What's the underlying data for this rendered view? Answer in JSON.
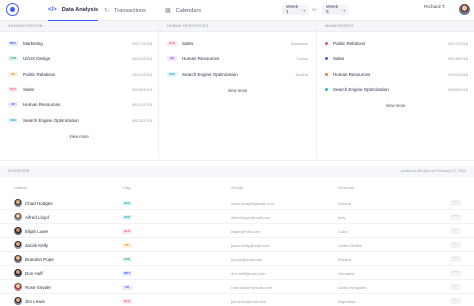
{
  "nav": {
    "tabs": [
      {
        "label": "Data Analysis",
        "icon": "code-icon"
      },
      {
        "label": "Transactions",
        "icon": "refresh-icon"
      },
      {
        "label": "Calendars",
        "icon": "calendar-icon"
      }
    ],
    "week_a": "Week 1",
    "vs": "vs",
    "week_b": "Week 5",
    "user_name": "Richard T."
  },
  "panels": {
    "administration": {
      "header": "ADMINISTRATION",
      "rows": [
        {
          "tag": "MKT",
          "label": "Marketing",
          "date": "05/17/2018"
        },
        {
          "tag": "UXD",
          "label": "UI/UX Design",
          "date": "05/16/2018"
        },
        {
          "tag": "PR",
          "label": "Public Relations",
          "date": "05/11/2018"
        },
        {
          "tag": "SLS",
          "label": "Sales",
          "date": "05/09/2018"
        },
        {
          "tag": "HR",
          "label": "Human Resources",
          "date": "06/01/2018"
        },
        {
          "tag": "SEO",
          "label": "Search Engine Optimization",
          "date": "08/25/2018"
        }
      ],
      "more": "View more"
    },
    "human_resources": {
      "header": "HUMAN RESOURCES",
      "rows": [
        {
          "tag": "SLS",
          "label": "Sales",
          "location": "Barbados"
        },
        {
          "tag": "HR",
          "label": "Human Resources",
          "location": "Turkey"
        },
        {
          "tag": "SEO",
          "label": "Search Engine Optimization",
          "location": "Austria"
        }
      ],
      "more": "View more"
    },
    "management": {
      "header": "MANAGEMENT",
      "rows": [
        {
          "label": "Public Relations",
          "date": "05/17/2018",
          "color": "#e2547a"
        },
        {
          "label": "Sales",
          "date": "05/16/2018",
          "color": "#3d5cff"
        },
        {
          "label": "Human Resources",
          "date": "05/11/2018",
          "color": "#f07a3a"
        },
        {
          "label": "Search Engine Optimization",
          "date": "05/09/2018",
          "color": "#22b8c8"
        }
      ],
      "more": "View more"
    }
  },
  "overview": {
    "title": "OVERVIEW",
    "note": "posted at 08:14pm on February 27, 2022",
    "columns": {
      "name": "Name",
      "tag": "Tag",
      "email": "Email",
      "country": "Country"
    },
    "rows": [
      {
        "name": "Chad Hodges",
        "tag": "SEO",
        "email": "chad.hodges@mail.com",
        "country": "Greece"
      },
      {
        "name": "Alfred Lloyd",
        "tag": "SEO",
        "email": "alfred.lloyd@mail.com",
        "country": "Italy"
      },
      {
        "name": "Elijah Lowe",
        "tag": "SLS",
        "email": "elijah@mail.com",
        "country": "Cuba"
      },
      {
        "name": "Jacob Kelly",
        "tag": "PR",
        "email": "jacob.kelly@mail.com",
        "country": "United States"
      },
      {
        "name": "Brandon Pope",
        "tag": "UXD",
        "email": "bpope@mail.com",
        "country": "Finland"
      },
      {
        "name": "Don Huff",
        "tag": "MKT",
        "email": "don.huff@mail.com",
        "country": "Germany"
      },
      {
        "name": "Rose Snyder",
        "tag": "HR",
        "email": "rose.snyder@mail.com",
        "country": "United Kingdom"
      },
      {
        "name": "Jim Lewis",
        "tag": "SLS",
        "email": "jim.lewis@mail.com",
        "country": "Argentina"
      }
    ]
  },
  "tag_colors": {
    "MKT": {
      "bg": "#e5e9ff",
      "fg": "#3d5cff"
    },
    "UXD": {
      "bg": "#e6f6ee",
      "fg": "#27a96a"
    },
    "PR": {
      "bg": "#fff0e2",
      "fg": "#f08a2a"
    },
    "SLS": {
      "bg": "#ffe5ec",
      "fg": "#e2547a"
    },
    "HR": {
      "bg": "#f0e5ff",
      "fg": "#8a4fe0"
    },
    "SEO": {
      "bg": "#e0f6f9",
      "fg": "#1aa6b8"
    }
  },
  "accent": "#3d5cff"
}
